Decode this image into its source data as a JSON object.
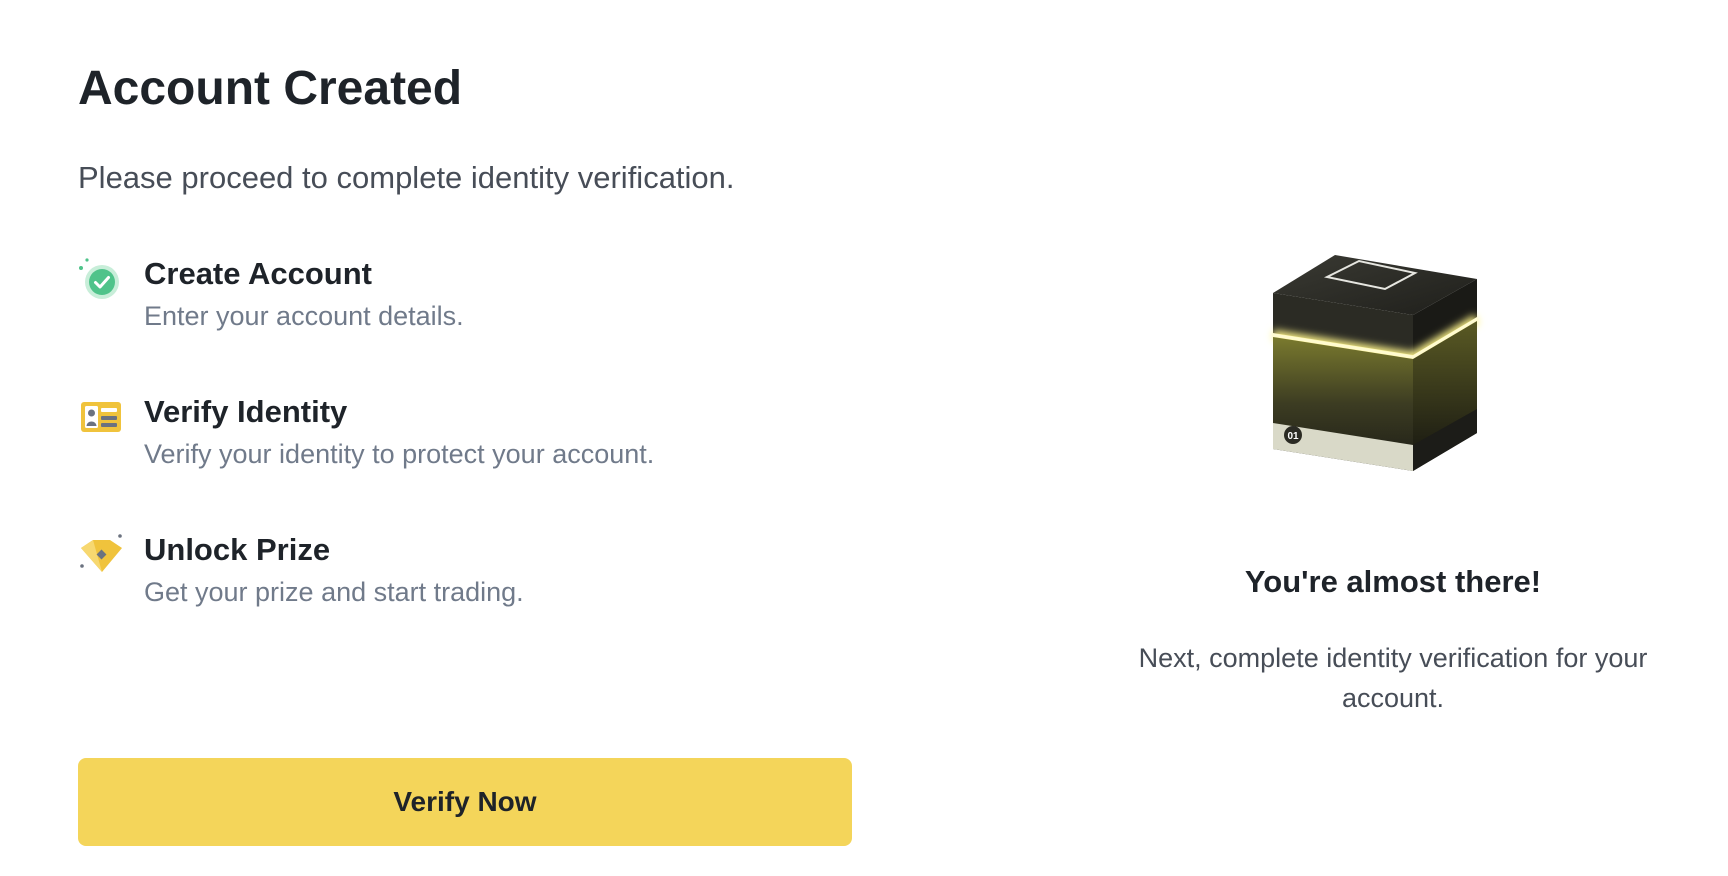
{
  "page": {
    "title": "Account Created",
    "subtitle": "Please proceed to complete identity verification."
  },
  "steps": [
    {
      "icon": "check-circle-icon",
      "title": "Create Account",
      "description": "Enter your account details.",
      "status": "completed"
    },
    {
      "icon": "id-card-icon",
      "title": "Verify Identity",
      "description": "Verify your identity to protect your account."
    },
    {
      "icon": "diamond-tag-icon",
      "title": "Unlock Prize",
      "description": "Get your prize and start trading."
    }
  ],
  "actions": {
    "verify_label": "Verify Now"
  },
  "promo": {
    "illustration": "mystery-box-illustration",
    "box_label": "01",
    "title": "You're almost there!",
    "description": "Next, complete identity verification for your account."
  },
  "colors": {
    "accent": "#f4d55a",
    "success": "#4fc38a",
    "text_primary": "#1e2329",
    "text_secondary": "#707a8a"
  }
}
